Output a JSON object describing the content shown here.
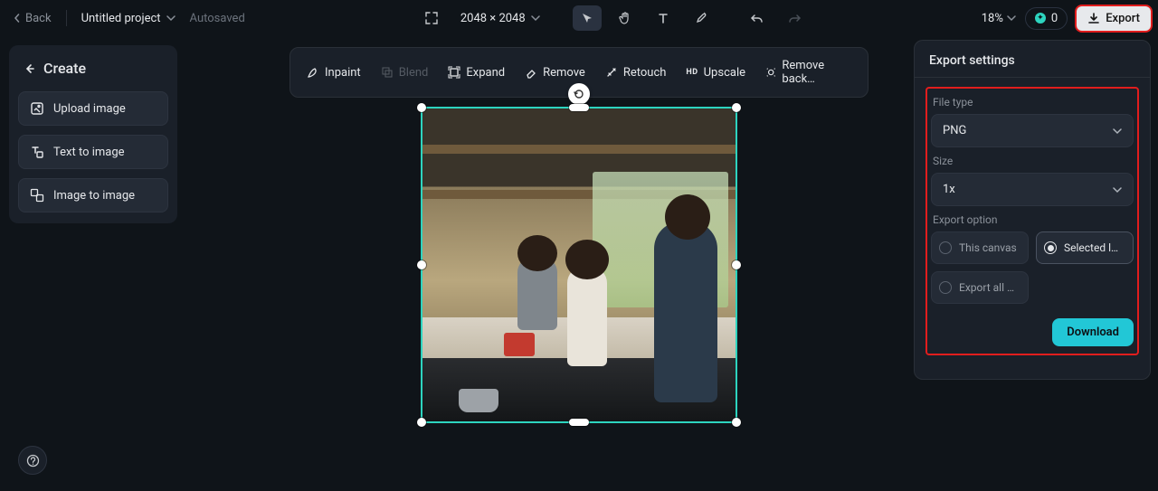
{
  "top": {
    "back": "Back",
    "project_title": "Untitled project",
    "autosaved": "Autosaved",
    "dimensions": "2048 × 2048",
    "zoom": "18%",
    "credits": "0",
    "export": "Export"
  },
  "sidebar": {
    "create": "Create",
    "upload": "Upload image",
    "text2img": "Text to image",
    "img2img": "Image to image"
  },
  "toolbar": {
    "inpaint": "Inpaint",
    "blend": "Blend",
    "expand": "Expand",
    "remove": "Remove",
    "retouch": "Retouch",
    "upscale": "Upscale",
    "removebg": "Remove back…"
  },
  "panel": {
    "title": "Export settings",
    "file_type_label": "File type",
    "file_type_value": "PNG",
    "size_label": "Size",
    "size_value": "1x",
    "export_option_label": "Export option",
    "opt_canvas": "This canvas",
    "opt_selected": "Selected l…",
    "opt_all": "Export all …",
    "download": "Download"
  },
  "canvas": {
    "image_alt": "Selected layer: photo of a woman and two children in a kitchen"
  }
}
